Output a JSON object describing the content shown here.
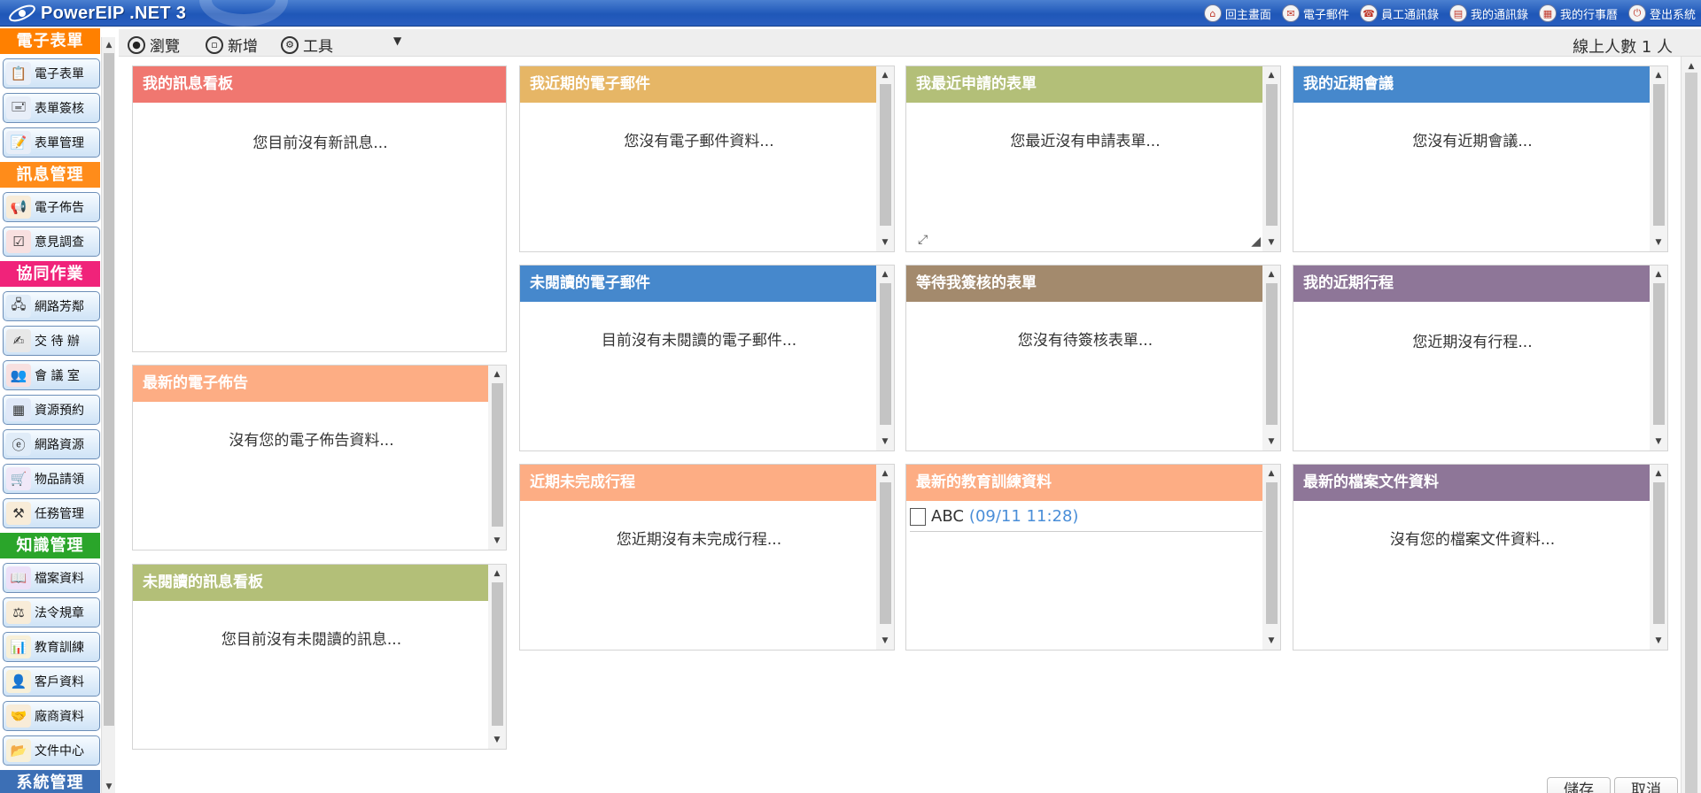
{
  "app": {
    "title": "PowerEIP .NET 3"
  },
  "topnav": [
    {
      "label": "回主畫面",
      "icon": "home-icon"
    },
    {
      "label": "電子郵件",
      "icon": "mail-icon"
    },
    {
      "label": "員工通訊錄",
      "icon": "contacts-icon"
    },
    {
      "label": "我的通訊錄",
      "icon": "address-book-icon"
    },
    {
      "label": "我的行事曆",
      "icon": "calendar-icon"
    },
    {
      "label": "登出系統",
      "icon": "logout-icon"
    }
  ],
  "sidebar": {
    "headers": {
      "forms": "電子表單",
      "messages": "訊息管理",
      "collab": "協同作業",
      "knowledge": "知識管理",
      "system": "系統管理"
    },
    "items": {
      "eform": "電子表單",
      "form_sign": "表單簽核",
      "form_manage": "表單管理",
      "bulletin": "電子佈告",
      "survey": "意見調查",
      "network_fang": "網路芳鄰",
      "todo": "交 待 辦",
      "meeting_room": "會 議 室",
      "resource_booking": "資源預約",
      "network_resource": "網路資源",
      "goods_request": "物品請領",
      "task_manage": "任務管理",
      "file_data": "檔案資料",
      "law": "法令規章",
      "training": "教育訓練",
      "customer": "客戶資料",
      "vendor": "廠商資料",
      "doc_center": "文件中心"
    },
    "colors": {
      "forms": "#ff8000",
      "messages": "#ff8c1a",
      "collab": "#f0237a",
      "knowledge": "#2aa52a",
      "system": "#3c6fb5"
    }
  },
  "toolbar": {
    "browse": "瀏覽",
    "add": "新增",
    "tools": "工具",
    "dropdown": "▼",
    "online": "線上人數 1 人"
  },
  "widgets": {
    "my_board": {
      "title": "我的訊息看板",
      "msg": "您目前沒有新訊息...",
      "color": "#f07770"
    },
    "latest_bulletin": {
      "title": "最新的電子佈告",
      "msg": "沒有您的電子佈告資料...",
      "color": "#fdad84"
    },
    "unread_board": {
      "title": "未閱讀的訊息看板",
      "msg": "您目前沒有未閱讀的訊息...",
      "color": "#b3bf78"
    },
    "recent_mail": {
      "title": "我近期的電子郵件",
      "msg": "您沒有電子郵件資料...",
      "color": "#e6b666"
    },
    "unread_mail": {
      "title": "未閱讀的電子郵件",
      "msg": "目前沒有未閱讀的電子郵件...",
      "color": "#4688cc"
    },
    "incomplete_sched": {
      "title": "近期未完成行程",
      "msg": "您近期沒有未完成行程...",
      "color": "#fdad84"
    },
    "recent_forms": {
      "title": "我最近申請的表單",
      "msg": "您最近沒有申請表單...",
      "color": "#b3bf78"
    },
    "pending_sign": {
      "title": "等待我簽核的表單",
      "msg": "您沒有待簽核表單...",
      "color": "#a38a6d"
    },
    "latest_training": {
      "title": "最新的教育訓練資料",
      "color": "#fdad84",
      "rows": [
        {
          "name": "ABC",
          "date": "(09/11 11:28)"
        }
      ]
    },
    "recent_meetings": {
      "title": "我的近期會議",
      "msg": "您沒有近期會議...",
      "color": "#4688cc"
    },
    "recent_sched": {
      "title": "我的近期行程",
      "msg": "您近期沒有行程...",
      "color": "#8e7698"
    },
    "latest_files": {
      "title": "最新的檔案文件資料",
      "msg": "沒有您的檔案文件資料...",
      "color": "#8e7698"
    }
  },
  "buttons": {
    "save": "儲存",
    "cancel": "取消"
  }
}
